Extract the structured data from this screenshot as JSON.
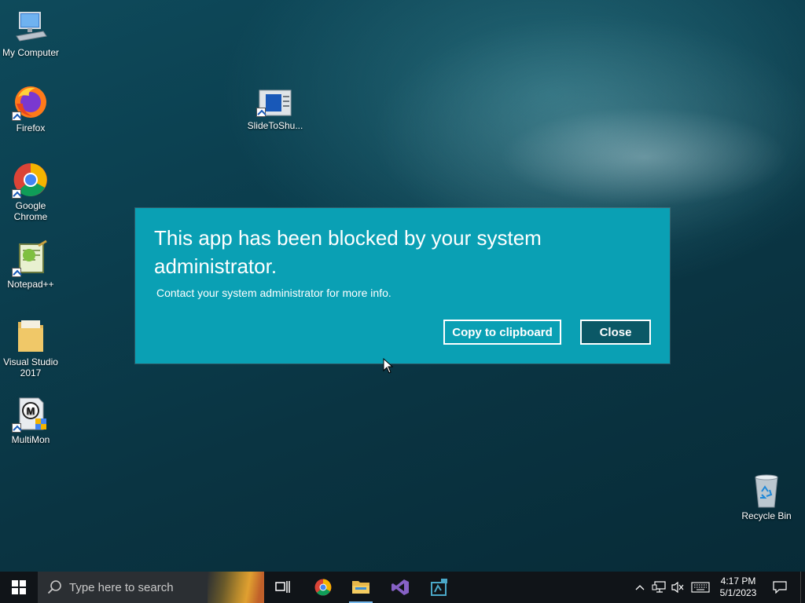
{
  "desktop": {
    "icons": [
      {
        "label": "My Computer",
        "icon": "computer-icon"
      },
      {
        "label": "Firefox",
        "icon": "firefox-icon"
      },
      {
        "label": "Google Chrome",
        "icon": "chrome-icon"
      },
      {
        "label": "Notepad++",
        "icon": "notepadpp-icon"
      },
      {
        "label": "Visual Studio 2017",
        "icon": "folder-icon"
      },
      {
        "label": "MultiMon",
        "icon": "multimon-icon"
      },
      {
        "label": "SlideToShu...",
        "icon": "slidetoshutdown-icon"
      },
      {
        "label": "Recycle Bin",
        "icon": "recycle-bin-icon"
      }
    ]
  },
  "dialog": {
    "title": "This app has been blocked by your system administrator.",
    "message": "Contact your system administrator for more info.",
    "copy_label": "Copy to clipboard",
    "close_label": "Close",
    "accent": "#0aa0b4"
  },
  "taskbar": {
    "search_placeholder": "Type here to search",
    "time": "4:17 PM",
    "date": "5/1/2023"
  }
}
